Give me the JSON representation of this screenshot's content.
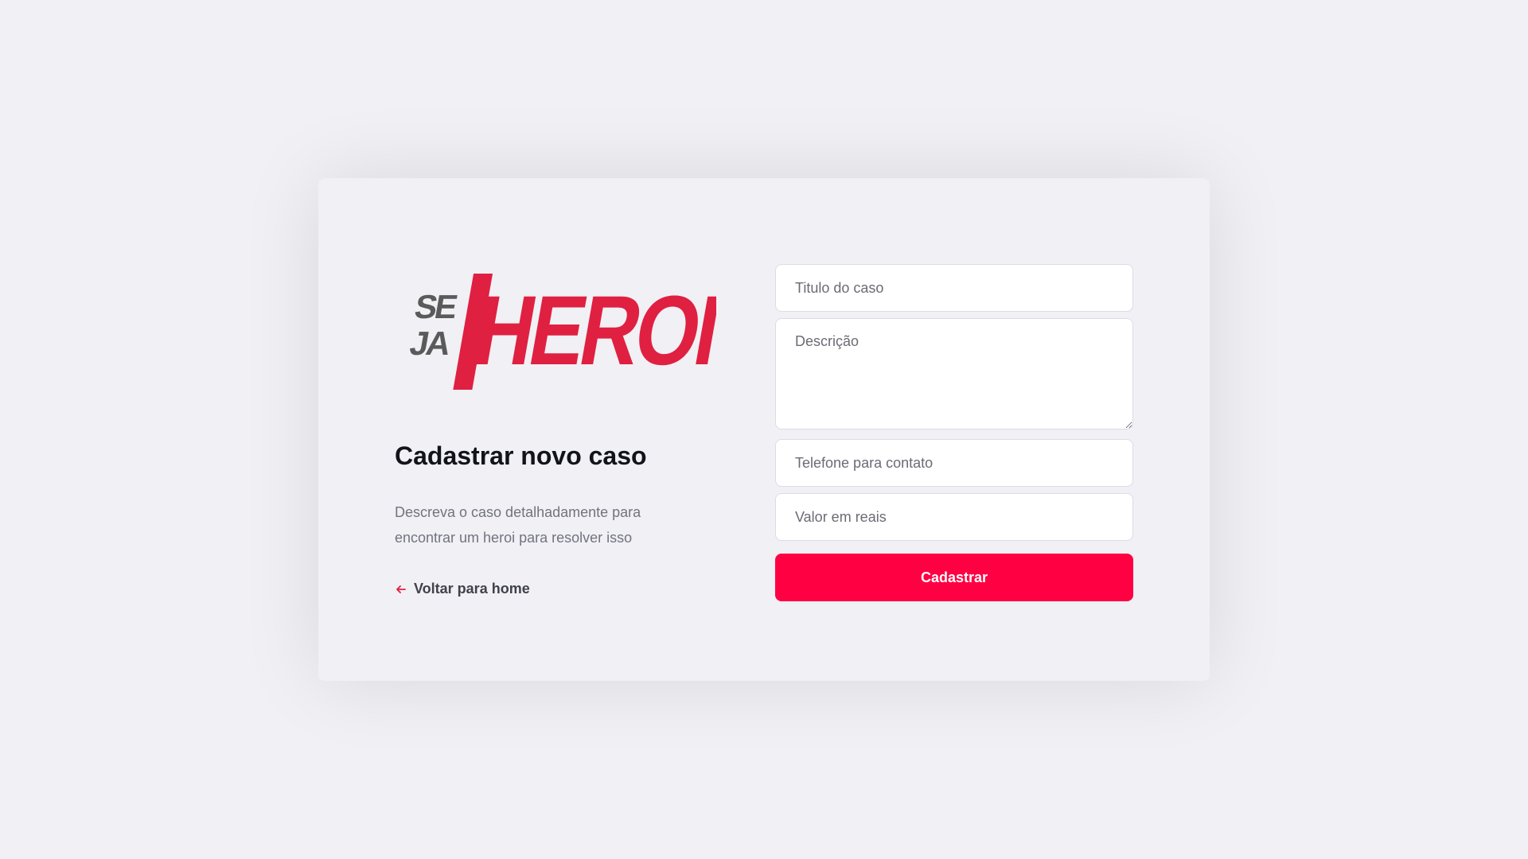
{
  "logo": {
    "text_small_top": "SE",
    "text_small_bottom": "JA",
    "text_large": "HEROI",
    "alt": "Se Ja Heroi"
  },
  "left": {
    "title": "Cadastrar novo caso",
    "description": "Descreva o caso detalhadamente para encontrar um heroi para resolver isso",
    "back_link": "Voltar para home",
    "back_icon": "arrow-left-icon"
  },
  "form": {
    "title_placeholder": "Titulo do caso",
    "description_placeholder": "Descrição",
    "phone_placeholder": "Telefone para contato",
    "value_placeholder": "Valor em reais",
    "submit_label": "Cadastrar"
  },
  "colors": {
    "accent": "#ff0042",
    "logo_red": "#e02041",
    "logo_gray": "#5a5a5a",
    "background": "#f0f0f5"
  }
}
